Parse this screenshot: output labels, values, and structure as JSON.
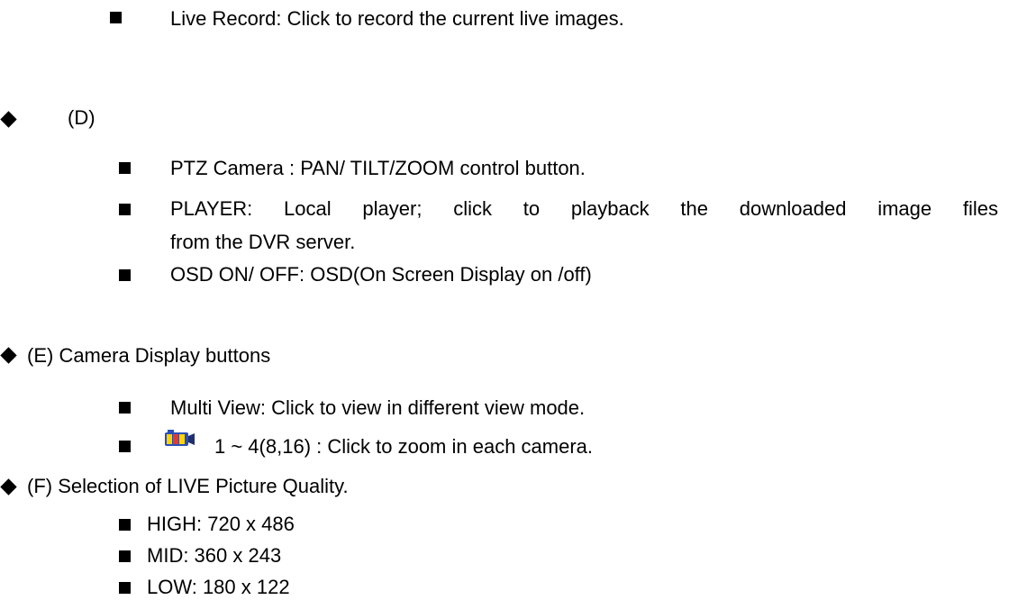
{
  "sections": {
    "top": {
      "item": "Live Record: Click to record the current live images."
    },
    "d": {
      "heading": "(D)",
      "items": [
        "PTZ Camera : PAN/ TILT/ZOOM control button.",
        "PLAYER: Local player; click to playback the downloaded image files",
        "from the DVR server.",
        "OSD ON/ OFF: OSD(On Screen Display on /off)"
      ]
    },
    "e": {
      "heading": "(E) Camera Display buttons",
      "items": [
        "Multi View: Click to view in different view mode.",
        "1 ~ 4(8,16) : Click to zoom in each camera."
      ],
      "icon": "camera-zoom-icon"
    },
    "f": {
      "heading": "(F) Selection of LIVE Picture Quality.",
      "items": [
        "HIGH: 720 x 486",
        "MID: 360 x 243",
        "LOW: 180 x 122"
      ]
    }
  }
}
